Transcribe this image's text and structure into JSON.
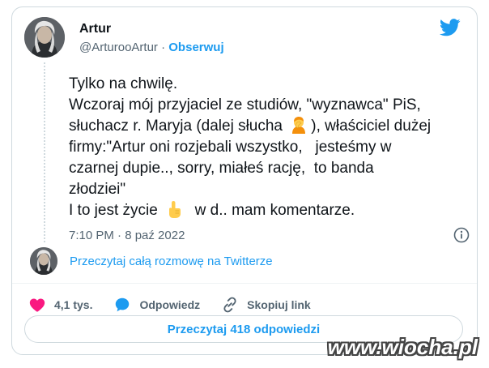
{
  "user": {
    "name": "Artur",
    "handle": "@ArturooArtur",
    "separator": "·",
    "follow_label": "Obserwuj"
  },
  "tweet": {
    "lines": [
      "Tylko na chwilę.",
      "Wczoraj mój przyjaciel ze studiów, \"wyznawca\" PiS,",
      "słuchacz r. Maryja (dalej słucha ",
      "), właściciel dużej",
      "firmy:\"Artur oni rozjebali wszystko,   jesteśmy w",
      "czarnej dupie.., sorry, miałeś rację,  to banda",
      "złodziei\"",
      "I to jest życie ",
      "  w d.. mam komentarze."
    ],
    "emojis": [
      "facepalm-person-emoji",
      "pointing-up-hand-emoji"
    ],
    "timestamp": "7:10 PM · 8 paź 2022"
  },
  "thread": {
    "read_label": "Przeczytaj całą rozmowę na Twitterze"
  },
  "actions": {
    "likes": "4,1 tys.",
    "reply": "Odpowiedz",
    "copy_link": "Skopiuj link"
  },
  "replies_button": "Przeczytaj 418 odpowiedzi",
  "watermark": "www.wiocha.pl",
  "colors": {
    "accent": "#1d9bf0",
    "like": "#f91880",
    "text": "#0f1419",
    "muted": "#536471"
  },
  "icons": [
    "twitter-bird-icon",
    "info-icon",
    "heart-icon",
    "reply-bubble-icon",
    "link-icon"
  ]
}
